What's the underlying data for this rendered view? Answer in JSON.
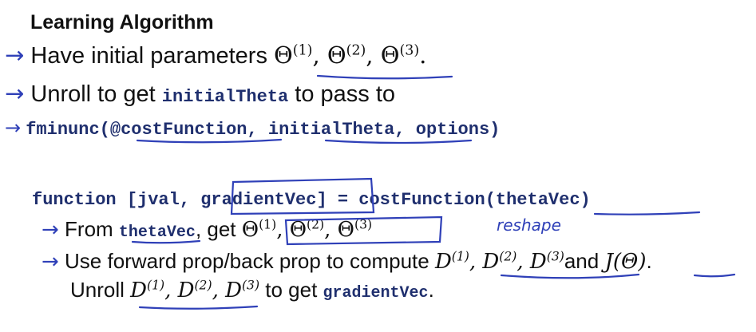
{
  "slide": {
    "title": "Learning Algorithm",
    "bullets": {
      "arrow": "→",
      "b1_text": "Have initial parameters ",
      "b1_math": [
        "Θ",
        "(1)",
        "Θ",
        "(2)",
        "Θ",
        "(3)"
      ],
      "b2_pre": "Unroll to get ",
      "b2_code": "initialTheta",
      "b2_post": " to pass to",
      "b3_code_1": "fminunc(@",
      "b3_code_2": "costFunction",
      "b3_code_3": ", ",
      "b3_code_4": "initialTheta",
      "b3_code_5": ", options)"
    },
    "function_block": {
      "line1_1": "function [jval, ",
      "line1_2": "gradientVec",
      "line1_3": "] = costFunction(",
      "line1_4": "thetaVec",
      "line1_5": ")",
      "from_pre": "From ",
      "from_code": "thetaVec",
      "from_mid": ",  get ",
      "use_text": "Use forward prop/back prop to compute ",
      "and_text": "and ",
      "j_theta": "J(Θ)",
      "unroll_pre": "Unroll ",
      "unroll_post": " to get ",
      "unroll_code": "gradientVec",
      "period": "."
    },
    "annotation": "reshape",
    "colors": {
      "ink": "#2f40b8",
      "code": "#1f2f6e",
      "text": "#111111"
    }
  }
}
